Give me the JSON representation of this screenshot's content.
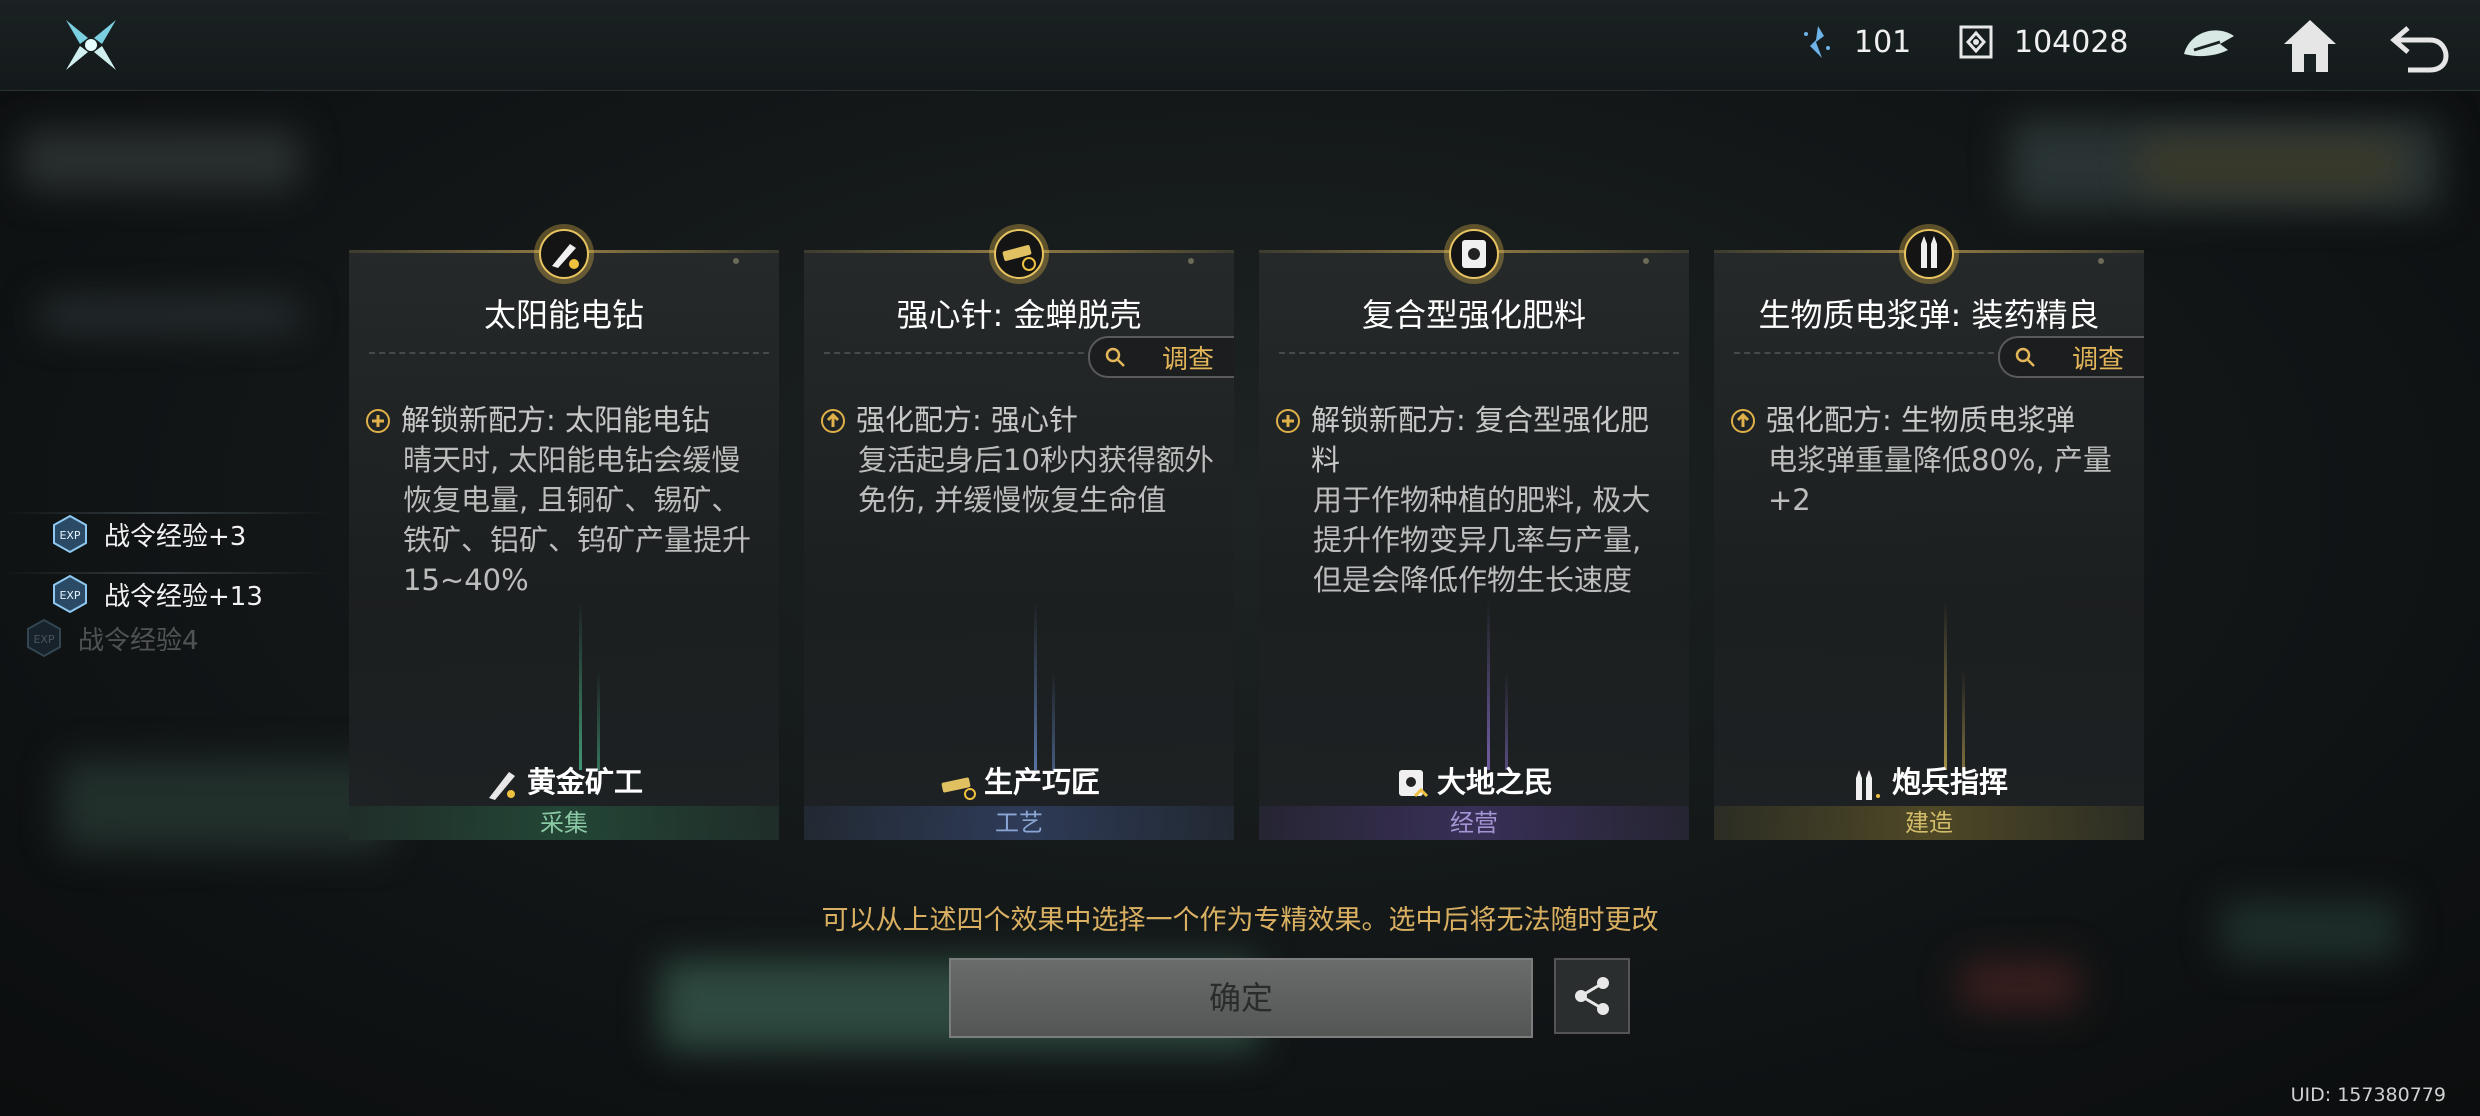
{
  "topbar": {
    "energy_value": "101",
    "coin_value": "104028"
  },
  "exp_rewards": [
    {
      "label": "战令经验+3"
    },
    {
      "label": "战令经验+13"
    },
    {
      "label": "战令经验4"
    }
  ],
  "cards": [
    {
      "title": "太阳能电钻",
      "effect_header": "解锁新配方: 太阳能电钻",
      "effect_body": "晴天时, 太阳能电钻会缓慢恢复电量, 且铜矿、锡矿、铁矿、铝矿、钨矿产量提升15~40%",
      "role": "黄金矿工",
      "category": "采集",
      "accent": "#3f8f6a",
      "has_investigate": false
    },
    {
      "title": "强心针: 金蝉脱壳",
      "effect_header": "强化配方: 强心针",
      "effect_body": "复活起身后10秒内获得额外免伤, 并缓慢恢复生命值",
      "role": "生产巧匠",
      "category": "工艺",
      "accent": "#4d6a9a",
      "has_investigate": true,
      "investigate_label": "调查"
    },
    {
      "title": "复合型强化肥料",
      "effect_header": "解锁新配方: 复合型强化肥料",
      "effect_body": "用于作物种植的肥料, 极大提升作物变异几率与产量, 但是会降低作物生长速度",
      "role": "大地之民",
      "category": "经营",
      "accent": "#6a5a9a",
      "has_investigate": false
    },
    {
      "title": "生物质电浆弹: 装药精良",
      "effect_header": "强化配方: 生物质电浆弹",
      "effect_body": "电浆弹重量降低80%, 产量+2",
      "role": "炮兵指挥",
      "category": "建造",
      "accent": "#9a8a3a",
      "has_investigate": true,
      "investigate_label": "调查"
    }
  ],
  "hint": "可以从上述四个效果中选择一个作为专精效果。选中后将无法随时更改",
  "confirm_label": "确定",
  "uid": "UID: 157380779"
}
